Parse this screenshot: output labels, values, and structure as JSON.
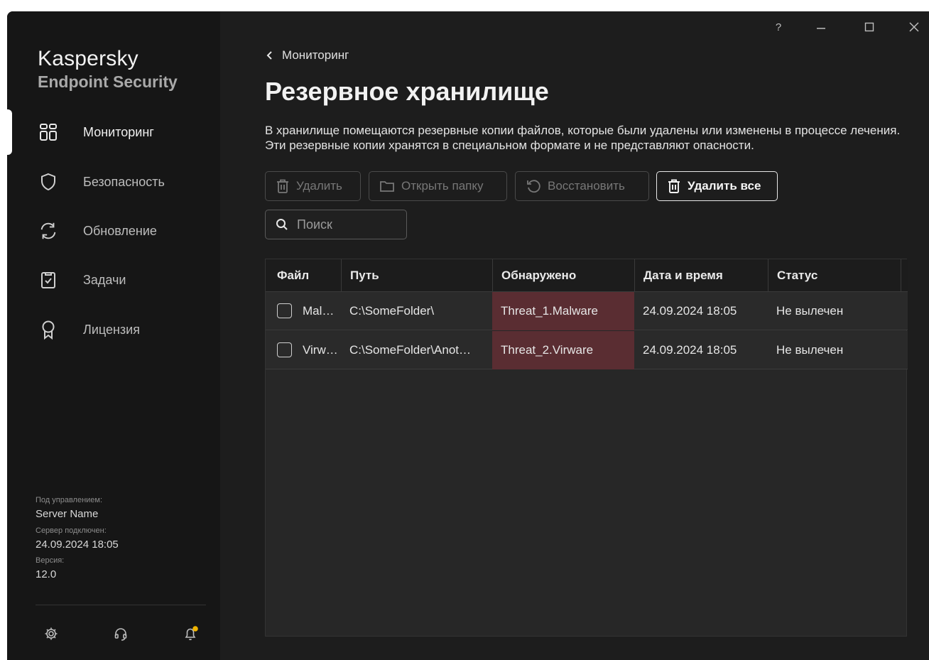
{
  "window": {
    "help_label": "?",
    "min_label": "—",
    "max_label": "☐",
    "close_label": "✕"
  },
  "brand": {
    "line1": "Kaspersky",
    "line2": "Endpoint Security"
  },
  "sidebar": {
    "items": [
      {
        "label": "Мониторинг",
        "icon": "dashboard-grid-icon",
        "active": true
      },
      {
        "label": "Безопасность",
        "icon": "shield-icon",
        "active": false
      },
      {
        "label": "Обновление",
        "icon": "refresh-icon",
        "active": false
      },
      {
        "label": "Задачи",
        "icon": "clipboard-check-icon",
        "active": false
      },
      {
        "label": "Лицензия",
        "icon": "badge-icon",
        "active": false
      }
    ],
    "info": {
      "managed_label": "Под управлением:",
      "managed_value": "Server Name",
      "server_label": "Сервер подключен:",
      "server_value": "24.09.2024 18:05",
      "version_label": "Версия:",
      "version_value": "12.0"
    },
    "bottom_icons": [
      "gear-icon",
      "headset-icon",
      "bell-icon"
    ]
  },
  "main": {
    "back_label": "Мониторинг",
    "title": "Резервное хранилище",
    "description": "В хранилище помещаются резервные копии файлов, которые были удалены или изменены в процессе лечения. Эти резервные копии хранятся в специальном формате и не представляют опасности.",
    "toolbar": {
      "delete_label": "Удалить",
      "open_folder_label": "Открыть папку",
      "restore_label": "Восстановить",
      "delete_all_label": "Удалить все"
    },
    "search": {
      "placeholder": "Поиск"
    },
    "table": {
      "columns": [
        "Файл",
        "Путь",
        "Обнаружено",
        "Дата и время",
        "Статус"
      ],
      "rows": [
        {
          "file": "Mal…",
          "path": "C:\\SomeFolder\\",
          "detected": "Threat_1.Malware",
          "datetime": "24.09.2024 18:05",
          "status": "Не вылечен"
        },
        {
          "file": "Virw…",
          "path": "C:\\SomeFolder\\Anot…",
          "detected": "Threat_2.Virware",
          "datetime": "24.09.2024 18:05",
          "status": "Не вылечен"
        }
      ]
    }
  },
  "colors": {
    "threat_bg": "#5a2d32",
    "notification_dot": "#f0b400",
    "bg": "#1d1d1d",
    "sidebar_bg": "#161616"
  }
}
